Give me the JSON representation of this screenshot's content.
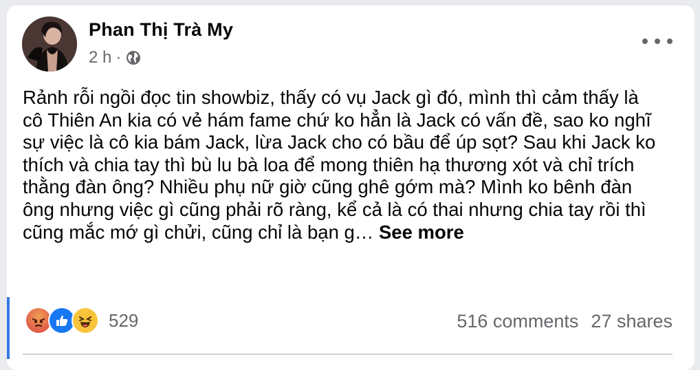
{
  "post": {
    "author": "Phan Thị Trà My",
    "time": "2 h",
    "separator": "·",
    "privacy_icon": "globe-icon",
    "more_icon": "more-horizontal-icon",
    "text": "Rảnh rỗi ngồi đọc tin showbiz, thấy có vụ Jack gì đó, mình thì cảm thấy là cô Thiên An kia có vẻ hám fame chứ ko hẳn là Jack có vấn đề, sao ko nghĩ sự việc là cô kia bám Jack, lừa Jack cho có bầu để úp sọt? Sau khi Jack ko thích và chia tay thì bù lu bà loa để mong thiên hạ thương xót và chỉ trích thằng đàn ông? Nhiều phụ nữ giờ cũng ghê gớm mà? Mình ko bênh đàn ông nhưng việc gì cũng phải rõ ràng, kể cả là có thai nhưng chia tay rồi thì cũng mắc mớ gì chửi, cũng chỉ là bạn g…",
    "see_more": "See more"
  },
  "engagement": {
    "reactions": [
      "angry-icon",
      "like-icon",
      "haha-icon"
    ],
    "reaction_count": "529",
    "comments": "516 comments",
    "shares": "27 shares"
  },
  "colors": {
    "like_blue": "#1877f2",
    "meta_gray": "#65676b",
    "accent": "#3578e5"
  }
}
